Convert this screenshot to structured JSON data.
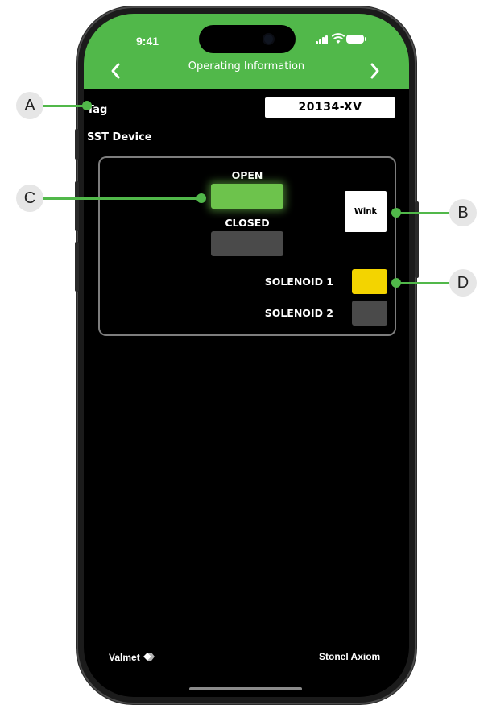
{
  "colors": {
    "header_green": "#51b84a",
    "open_indicator": "#6dc34c",
    "solenoid1_indicator": "#f3d400",
    "inactive_indicator": "#4a4a4a",
    "callout_line": "#51b84a"
  },
  "status_bar": {
    "time": "9:41"
  },
  "nav": {
    "title": "Operating Information",
    "back_icon": "chevron-left-icon",
    "forward_icon": "chevron-right-icon"
  },
  "tag": {
    "label": "Tag",
    "value": "20134-XV"
  },
  "device": {
    "label": "SST Device"
  },
  "indicators": {
    "open_label": "OPEN",
    "closed_label": "CLOSED",
    "solenoid1_label": "SOLENOID 1",
    "solenoid2_label": "SOLENOID 2",
    "wink_label": "Wink"
  },
  "footer": {
    "brand_left": "Valmet",
    "brand_right": "Stonel Axiom"
  },
  "callouts": {
    "a": "A",
    "b": "B",
    "c": "C",
    "d": "D"
  }
}
